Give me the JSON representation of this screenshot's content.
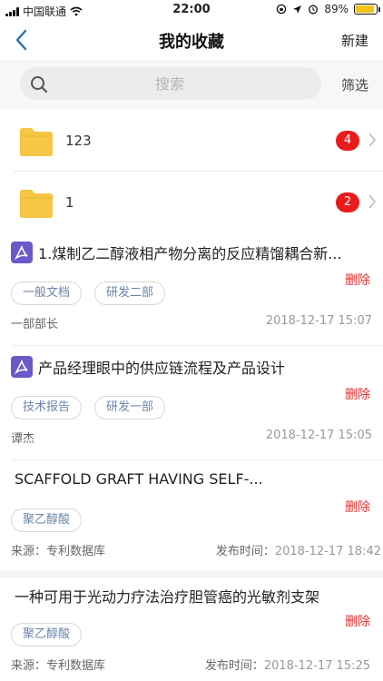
{
  "status_bar": {
    "carrier": "中国联通",
    "time": "22:00",
    "battery": "89%",
    "battery_level": 0.89
  },
  "nav": {
    "title": "我的收藏",
    "new_label": "新建"
  },
  "search": {
    "placeholder": "搜索",
    "filter_label": "筛选"
  },
  "folders": [
    {
      "name": "123",
      "count": "4"
    },
    {
      "name": "1",
      "count": "2"
    }
  ],
  "items": [
    {
      "title": "1.煤制乙二醇液相产物分离的反应精馏耦合新...",
      "tags": [
        "一般文档",
        "研发二部"
      ],
      "delete_label": "删除",
      "author": "一部部长",
      "time": "2018-12-17 15:07"
    },
    {
      "title": "产品经理眼中的供应链流程及产品设计",
      "tags": [
        "技术报告",
        "研发一部"
      ],
      "delete_label": "删除",
      "author": "谭杰",
      "time": "2018-12-17 15:05"
    },
    {
      "title": "SCAFFOLD GRAFT HAVING SELF-...",
      "tags": [
        "聚乙醇酸"
      ],
      "delete_label": "删除",
      "source": "来源：专利数据库",
      "publish_label": "发布时间：",
      "time": "2018-12-17 18:42"
    },
    {
      "title": "一种可用于光动力疗法治疗胆管癌的光敏剂支架",
      "tags": [
        "聚乙醇酸"
      ],
      "delete_label": "删除",
      "source": "来源：专利数据库",
      "publish_label": "发布时间：",
      "time": "2018-12-17 15:25"
    }
  ],
  "colors": {
    "badge": "#ea1a1a",
    "delete": "#e5312f",
    "pdf_icon": "#6b59c9",
    "folder": "#f6c644",
    "tag_text": "#6a86a8"
  },
  "icons": [
    "back-chevron-icon",
    "search-icon",
    "folder-icon",
    "pdf-icon",
    "chevron-right-icon",
    "wifi-icon",
    "alarm-icon",
    "location-icon",
    "battery-icon"
  ]
}
